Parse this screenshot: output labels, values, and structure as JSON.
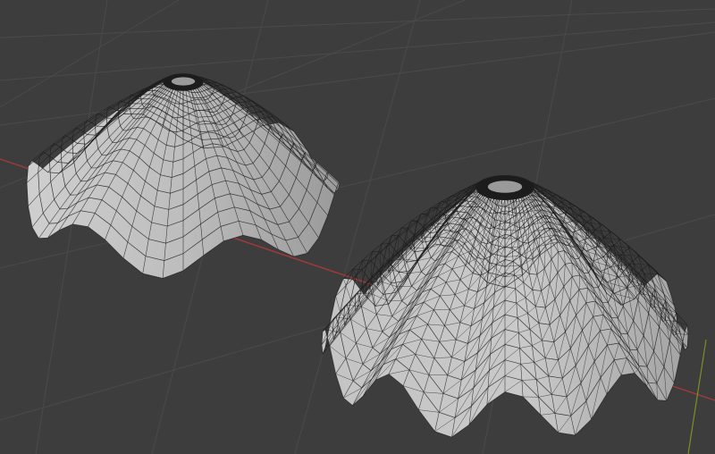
{
  "viewport": {
    "background_color": "#3d3d3d",
    "grid_color": "#4a4a4a",
    "x_axis_color": "#9c3a3a",
    "z_axis_color": "#7a8f2a"
  },
  "objects": [
    {
      "id": "cloth-mesh-quad",
      "topology": "quad",
      "fill_color": "#b8b8b8",
      "wire_color": "#1e1e1e"
    },
    {
      "id": "cloth-mesh-tri",
      "topology": "triangulated",
      "fill_color": "#bcbcbc",
      "wire_color": "#1e1e1e"
    }
  ]
}
